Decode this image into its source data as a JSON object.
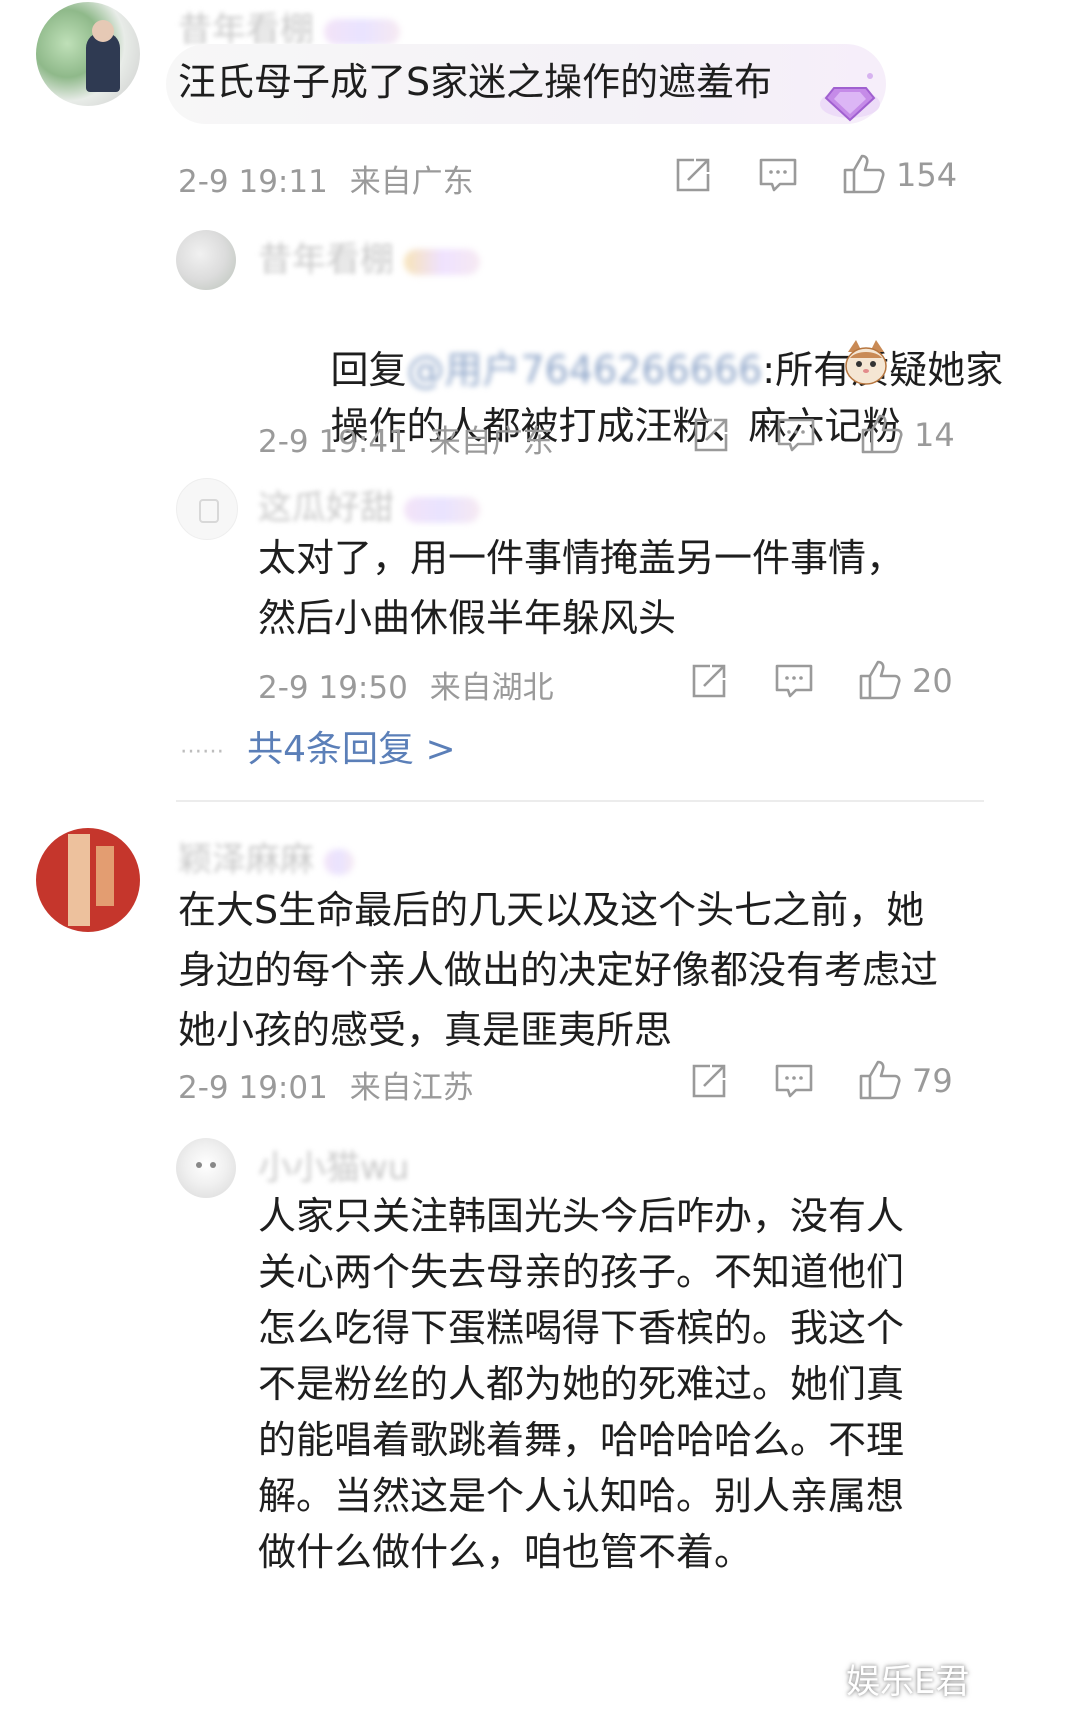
{
  "comments": [
    {
      "id": "c1",
      "user": "昔年看棚",
      "text": "汪氏母子成了S家迷之操作的遮羞布",
      "time": "2-9 19:11",
      "location": "来自广东",
      "likes": "154",
      "avatar_icon": "photo-avatar",
      "badge_icon": "diamond-badge-icon",
      "replies": [
        {
          "id": "r1",
          "user": "昔年看棚",
          "reply_prefix": "回复",
          "mention": "@用户7646266666",
          "text_after": ":所有质疑她家",
          "text_line2": "操作的人都被打成汪粉、麻六记粉",
          "time": "2-9 19:41",
          "location": "来自广东",
          "likes": "14"
        },
        {
          "id": "r2",
          "user": "这瓜好甜",
          "text": "太对了，用一件事情掩盖另一件事情，\n然后小曲休假半年躲风头",
          "time": "2-9 19:50",
          "location": "来自湖北",
          "likes": "20"
        }
      ],
      "more": {
        "dots": "……",
        "label": "共4条回复 >"
      }
    },
    {
      "id": "c2",
      "user": "颖泽麻麻",
      "text": "在大S生命最后的几天以及这个头七之前，她\n身边的每个亲人做出的决定好像都没有考虑过\n她小孩的感受，真是匪夷所思",
      "time": "2-9 19:01",
      "location": "来自江苏",
      "likes": "79",
      "replies": [
        {
          "id": "r3",
          "user": "小小猫wu",
          "text": "人家只关注韩国光头今后咋办，没有人\n关心两个失去母亲的孩子。不知道他们\n怎么吃得下蛋糕喝得下香槟的。我这个\n不是粉丝的人都为她的死难过。她们真\n的能唱着歌跳着舞，哈哈哈哈么。不理\n解。当然这是个人认知哈。别人亲属想\n做什么做什么，咱也管不着。"
        }
      ]
    }
  ],
  "watermark": "娱乐E君",
  "colors": {
    "link": "#5b7fb8",
    "meta": "#9a9a9a",
    "text": "#1e1e1e"
  }
}
